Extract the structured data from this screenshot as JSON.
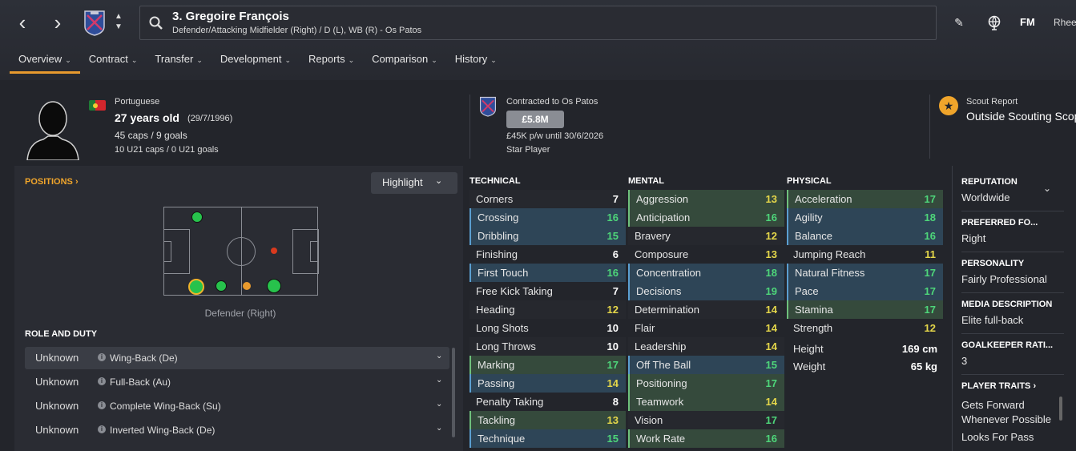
{
  "header": {
    "player_name": "3. Gregoire François",
    "player_sub": "Defender/Attacking Midfielder (Right) / D (L), WB (R) - Os Patos",
    "fm_label": "FM",
    "user_label": "Rhee"
  },
  "nav": {
    "tabs": [
      {
        "label": "Overview"
      },
      {
        "label": "Contract"
      },
      {
        "label": "Transfer"
      },
      {
        "label": "Development"
      },
      {
        "label": "Reports"
      },
      {
        "label": "Comparison"
      },
      {
        "label": "History"
      }
    ]
  },
  "info": {
    "nationality": "Portuguese",
    "age": "27 years old",
    "dob": "(29/7/1996)",
    "caps": "45 caps / 9 goals",
    "u21": "10 U21 caps / 0 U21 goals",
    "contract_title": "Contracted to Os Patos",
    "value": "£5.8M",
    "wage": "£45K p/w until 30/6/2026",
    "status": "Star Player",
    "scout_title": "Scout Report",
    "scout_value": "Outside Scouting Scope"
  },
  "positions": {
    "title": "POSITIONS",
    "highlight_label": "Highlight",
    "pitch_caption": "Defender (Right)"
  },
  "roles": {
    "title": "ROLE AND DUTY",
    "items": [
      {
        "ability": "Unknown",
        "role": "Wing-Back (De)"
      },
      {
        "ability": "Unknown",
        "role": "Full-Back (Au)"
      },
      {
        "ability": "Unknown",
        "role": "Complete Wing-Back (Su)"
      },
      {
        "ability": "Unknown",
        "role": "Inverted Wing-Back (De)"
      }
    ]
  },
  "attributes": {
    "technical_title": "TECHNICAL",
    "mental_title": "MENTAL",
    "physical_title": "PHYSICAL",
    "technical": [
      {
        "name": "Corners",
        "value": "7"
      },
      {
        "name": "Crossing",
        "value": "16"
      },
      {
        "name": "Dribbling",
        "value": "15"
      },
      {
        "name": "Finishing",
        "value": "6"
      },
      {
        "name": "First Touch",
        "value": "16"
      },
      {
        "name": "Free Kick Taking",
        "value": "7"
      },
      {
        "name": "Heading",
        "value": "12"
      },
      {
        "name": "Long Shots",
        "value": "10"
      },
      {
        "name": "Long Throws",
        "value": "10"
      },
      {
        "name": "Marking",
        "value": "17"
      },
      {
        "name": "Passing",
        "value": "14"
      },
      {
        "name": "Penalty Taking",
        "value": "8"
      },
      {
        "name": "Tackling",
        "value": "13"
      },
      {
        "name": "Technique",
        "value": "15"
      }
    ],
    "mental": [
      {
        "name": "Aggression",
        "value": "13"
      },
      {
        "name": "Anticipation",
        "value": "16"
      },
      {
        "name": "Bravery",
        "value": "12"
      },
      {
        "name": "Composure",
        "value": "13"
      },
      {
        "name": "Concentration",
        "value": "18"
      },
      {
        "name": "Decisions",
        "value": "19"
      },
      {
        "name": "Determination",
        "value": "14"
      },
      {
        "name": "Flair",
        "value": "14"
      },
      {
        "name": "Leadership",
        "value": "14"
      },
      {
        "name": "Off The Ball",
        "value": "15"
      },
      {
        "name": "Positioning",
        "value": "17"
      },
      {
        "name": "Teamwork",
        "value": "14"
      },
      {
        "name": "Vision",
        "value": "17"
      },
      {
        "name": "Work Rate",
        "value": "16"
      }
    ],
    "physical": [
      {
        "name": "Acceleration",
        "value": "17"
      },
      {
        "name": "Agility",
        "value": "18"
      },
      {
        "name": "Balance",
        "value": "16"
      },
      {
        "name": "Jumping Reach",
        "value": "11"
      },
      {
        "name": "Natural Fitness",
        "value": "17"
      },
      {
        "name": "Pace",
        "value": "17"
      },
      {
        "name": "Stamina",
        "value": "17"
      },
      {
        "name": "Strength",
        "value": "12"
      }
    ],
    "height_label": "Height",
    "height": "169 cm",
    "weight_label": "Weight",
    "weight": "65 kg"
  },
  "side": {
    "reputation_title": "REPUTATION",
    "reputation": "Worldwide",
    "foot_title": "PREFERRED FO...",
    "foot": "Right",
    "personality_title": "PERSONALITY",
    "personality": "Fairly Professional",
    "media_title": "MEDIA DESCRIPTION",
    "media": "Elite full-back",
    "gk_title": "GOALKEEPER RATI...",
    "gk": "3",
    "traits_title": "PLAYER TRAITS",
    "traits": [
      "Gets Forward Whenever Possible",
      "Looks For Pass"
    ]
  },
  "colors": {
    "accent": "#e89a2e",
    "high": "#4ed67a",
    "mid": "#e5d74a",
    "low": "#ffffff"
  }
}
